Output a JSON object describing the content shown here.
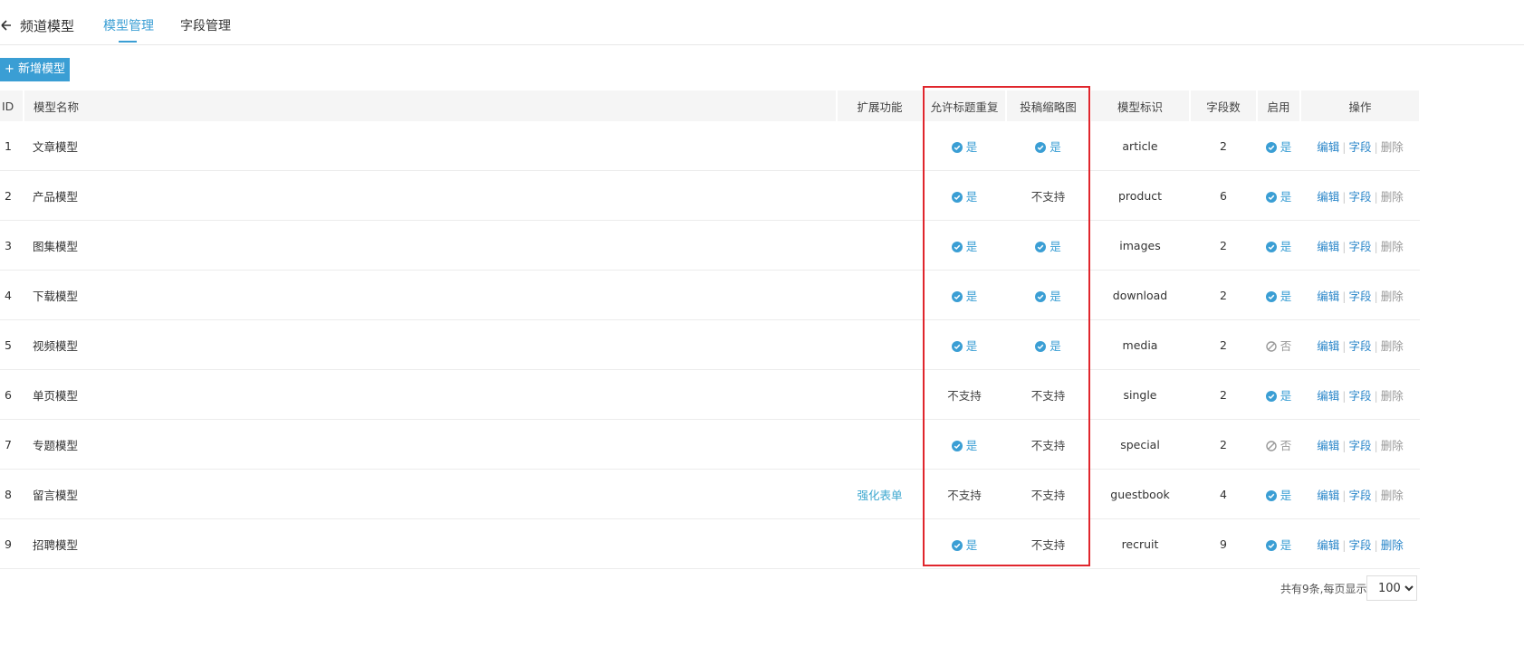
{
  "header": {
    "title": "频道模型",
    "tabs": [
      {
        "label": "模型管理",
        "active": true
      },
      {
        "label": "字段管理",
        "active": false
      }
    ]
  },
  "toolbar": {
    "add_label": "+ 新增模型"
  },
  "table": {
    "columns": {
      "id": "ID",
      "name": "模型名称",
      "ext": "扩展功能",
      "allow_dup": "允许标题重复",
      "thumb": "投稿缩略图",
      "ident": "模型标识",
      "fields": "字段数",
      "enabled": "启用",
      "actions": "操作"
    },
    "rows": [
      {
        "id": "1",
        "name": "文章模型",
        "ext": "",
        "allow_dup": "是",
        "thumb": "是",
        "ident": "article",
        "fields": "2",
        "enabled": "是"
      },
      {
        "id": "2",
        "name": "产品模型",
        "ext": "",
        "allow_dup": "是",
        "thumb": "不支持",
        "ident": "product",
        "fields": "6",
        "enabled": "是"
      },
      {
        "id": "3",
        "name": "图集模型",
        "ext": "",
        "allow_dup": "是",
        "thumb": "是",
        "ident": "images",
        "fields": "2",
        "enabled": "是"
      },
      {
        "id": "4",
        "name": "下载模型",
        "ext": "",
        "allow_dup": "是",
        "thumb": "是",
        "ident": "download",
        "fields": "2",
        "enabled": "是"
      },
      {
        "id": "5",
        "name": "视频模型",
        "ext": "",
        "allow_dup": "是",
        "thumb": "是",
        "ident": "media",
        "fields": "2",
        "enabled": "否"
      },
      {
        "id": "6",
        "name": "单页模型",
        "ext": "",
        "allow_dup": "不支持",
        "thumb": "不支持",
        "ident": "single",
        "fields": "2",
        "enabled": "是"
      },
      {
        "id": "7",
        "name": "专题模型",
        "ext": "",
        "allow_dup": "是",
        "thumb": "不支持",
        "ident": "special",
        "fields": "2",
        "enabled": "否"
      },
      {
        "id": "8",
        "name": "留言模型",
        "ext": "强化表单",
        "allow_dup": "不支持",
        "thumb": "不支持",
        "ident": "guestbook",
        "fields": "4",
        "enabled": "是"
      },
      {
        "id": "9",
        "name": "招聘模型",
        "ext": "",
        "allow_dup": "是",
        "thumb": "不支持",
        "ident": "recruit",
        "fields": "9",
        "enabled": "是"
      }
    ],
    "actions": {
      "edit": "编辑",
      "field": "字段",
      "delete": "删除"
    }
  },
  "pagination": {
    "summary": "共有9条,每页显示",
    "page_size": "100",
    "page_size_options": [
      "100"
    ]
  },
  "colors": {
    "accent": "#3a9ed4",
    "highlight_border": "#e0262d",
    "muted": "#999999"
  },
  "icons": {
    "yes": "check-circle-icon",
    "no": "ban-icon",
    "back": "arrow-left-icon"
  }
}
